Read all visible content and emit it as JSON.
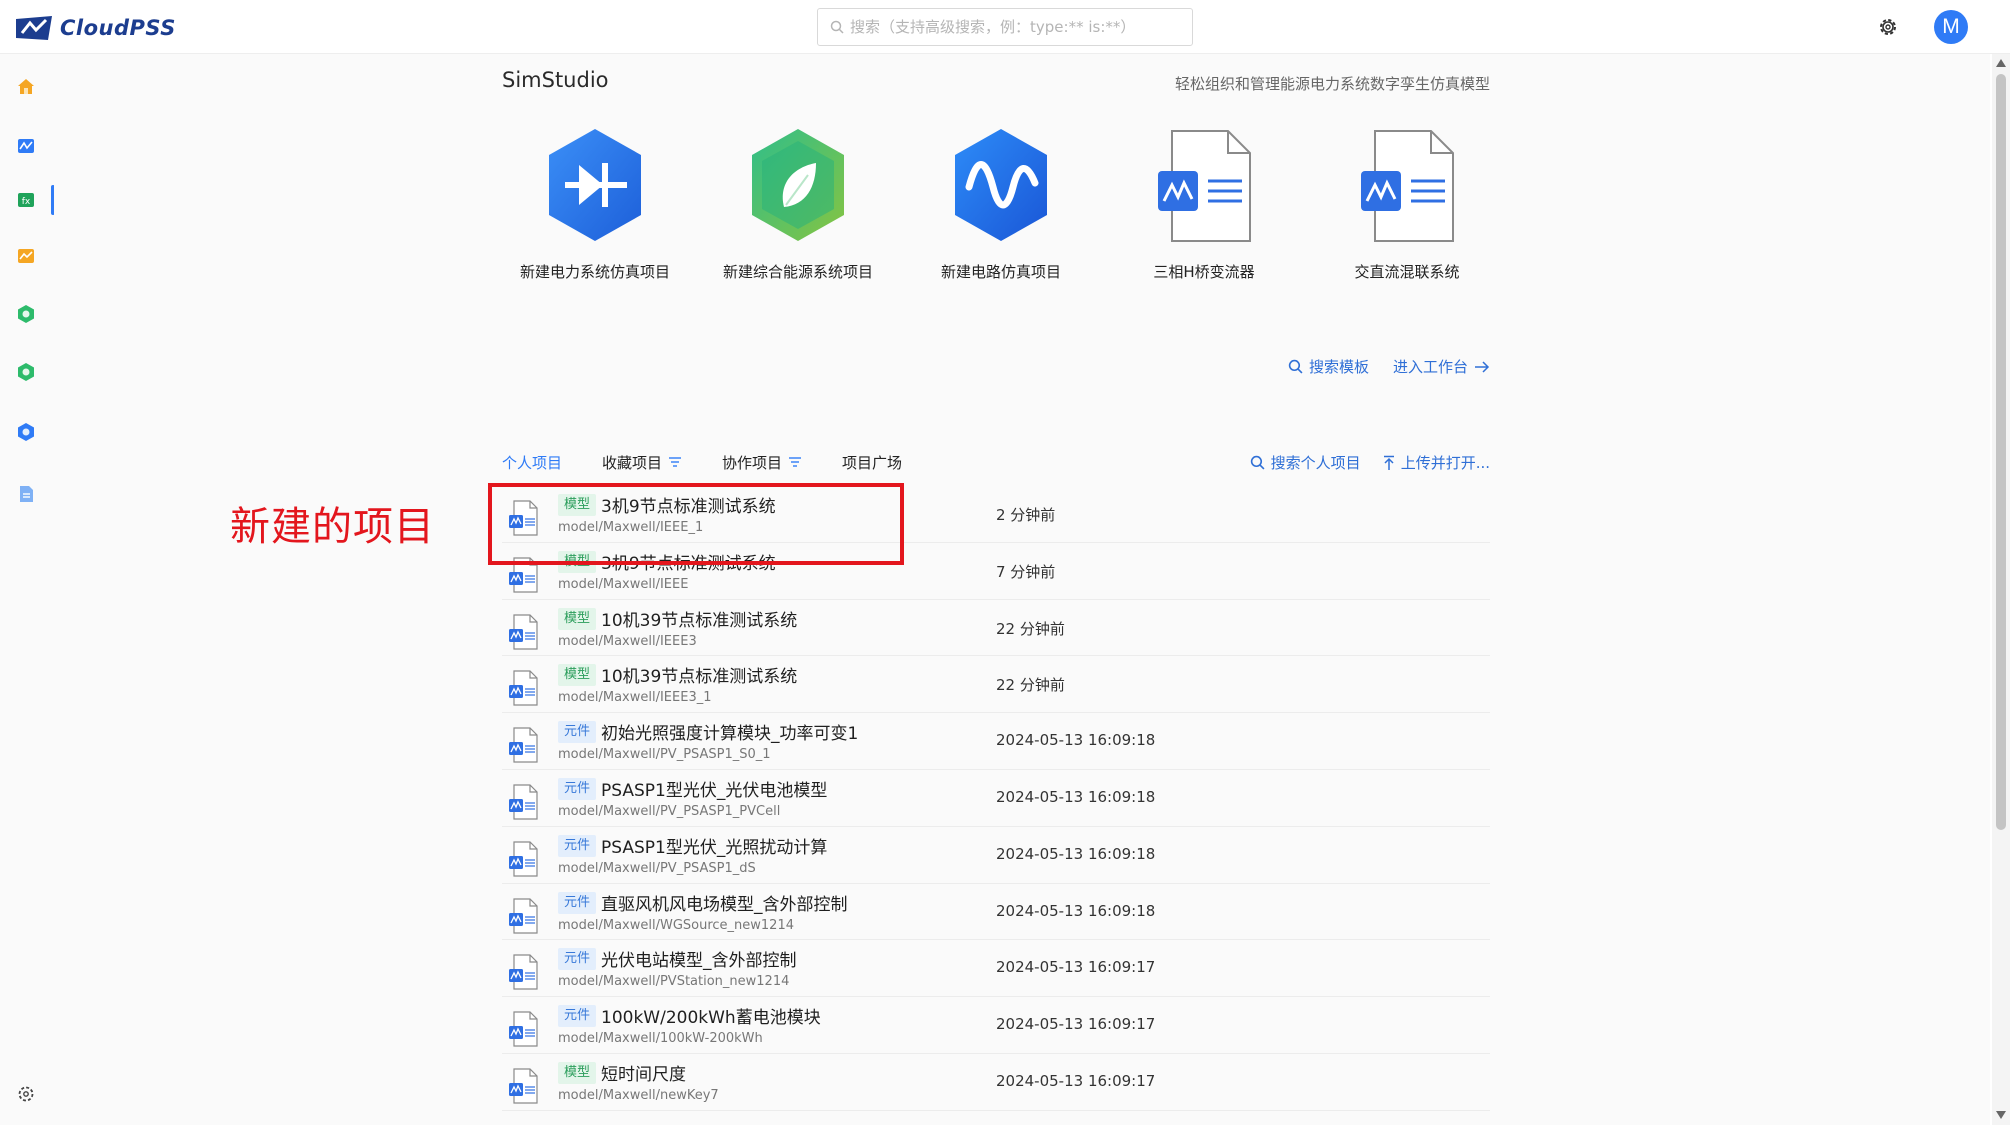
{
  "header": {
    "logo_text": "CloudPSS",
    "search_placeholder": "搜索（支持高级搜索，例：type:** is:**）",
    "avatar_letter": "M"
  },
  "sidebar": {
    "items": [
      {
        "icon": "home-icon"
      },
      {
        "icon": "simstudio-icon",
        "active": true
      },
      {
        "icon": "functionstudio-icon"
      },
      {
        "icon": "appstudio-icon"
      },
      {
        "icon": "green-hex-icon-1"
      },
      {
        "icon": "green-hex-icon-2"
      },
      {
        "icon": "blue-hex-icon"
      },
      {
        "icon": "doc-icon"
      }
    ],
    "settings_icon": "gear-icon"
  },
  "page": {
    "title": "SimStudio",
    "subtitle": "轻松组织和管理能源电力系统数字孪生仿真模型"
  },
  "templates": [
    {
      "label": "新建电力系统仿真项目",
      "icon": "power-system-icon"
    },
    {
      "label": "新建综合能源系统项目",
      "icon": "integrated-energy-icon"
    },
    {
      "label": "新建电路仿真项目",
      "icon": "circuit-icon"
    },
    {
      "label": "三相H桥变流器",
      "icon": "document-chart-icon"
    },
    {
      "label": "交直流混联系统",
      "icon": "document-chart-icon"
    }
  ],
  "template_links": {
    "search_templates": "搜索模板",
    "enter_workbench": "进入工作台"
  },
  "tabs": [
    {
      "label": "个人项目",
      "active": true,
      "filter": false
    },
    {
      "label": "收藏项目",
      "active": false,
      "filter": true
    },
    {
      "label": "协作项目",
      "active": false,
      "filter": true
    },
    {
      "label": "项目广场",
      "active": false,
      "filter": false
    }
  ],
  "tab_actions": {
    "search_personal": "搜索个人项目",
    "upload_open": "上传并打开..."
  },
  "projects": [
    {
      "tag": "模型",
      "tag_type": "model",
      "name": "3机9节点标准测试系统",
      "path": "model/Maxwell/IEEE_1",
      "time": "2 分钟前"
    },
    {
      "tag": "模型",
      "tag_type": "model",
      "name": "3机9节点标准测试系统",
      "path": "model/Maxwell/IEEE",
      "time": "7 分钟前"
    },
    {
      "tag": "模型",
      "tag_type": "model",
      "name": "10机39节点标准测试系统",
      "path": "model/Maxwell/IEEE3",
      "time": "22 分钟前"
    },
    {
      "tag": "模型",
      "tag_type": "model",
      "name": "10机39节点标准测试系统",
      "path": "model/Maxwell/IEEE3_1",
      "time": "22 分钟前"
    },
    {
      "tag": "元件",
      "tag_type": "comp",
      "name": "初始光照强度计算模块_功率可变1",
      "path": "model/Maxwell/PV_PSASP1_S0_1",
      "time": "2024-05-13 16:09:18"
    },
    {
      "tag": "元件",
      "tag_type": "comp",
      "name": "PSASP1型光伏_光伏电池模型",
      "path": "model/Maxwell/PV_PSASP1_PVCell",
      "time": "2024-05-13 16:09:18"
    },
    {
      "tag": "元件",
      "tag_type": "comp",
      "name": "PSASP1型光伏_光照扰动计算",
      "path": "model/Maxwell/PV_PSASP1_dS",
      "time": "2024-05-13 16:09:18"
    },
    {
      "tag": "元件",
      "tag_type": "comp",
      "name": "直驱风机风电场模型_含外部控制",
      "path": "model/Maxwell/WGSource_new1214",
      "time": "2024-05-13 16:09:18"
    },
    {
      "tag": "元件",
      "tag_type": "comp",
      "name": "光伏电站模型_含外部控制",
      "path": "model/Maxwell/PVStation_new1214",
      "time": "2024-05-13 16:09:17"
    },
    {
      "tag": "元件",
      "tag_type": "comp",
      "name": "100kW/200kWh蓄电池模块",
      "path": "model/Maxwell/100kW-200kWh",
      "time": "2024-05-13 16:09:17"
    },
    {
      "tag": "模型",
      "tag_type": "model",
      "name": "短时间尺度",
      "path": "model/Maxwell/newKey7",
      "time": "2024-05-13 16:09:17"
    }
  ],
  "annotation": {
    "text": "新建的项目",
    "color": "#e3161d"
  },
  "colors": {
    "accent": "#2f7bf6",
    "link": "#2f6fd6",
    "tag_model_bg": "#e3f5ea",
    "tag_model_fg": "#2c9e5c",
    "tag_comp_bg": "#e3eefc",
    "tag_comp_fg": "#3879d9"
  }
}
